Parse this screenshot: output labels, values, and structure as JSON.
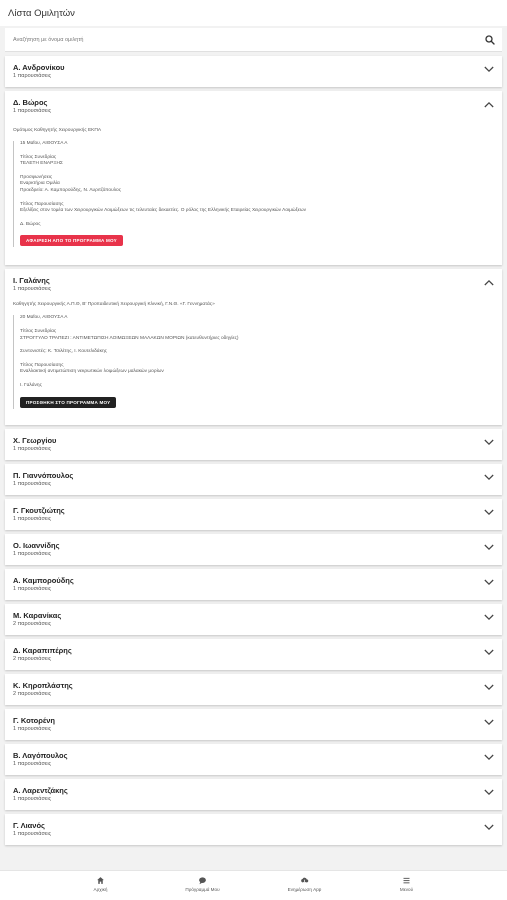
{
  "header": {
    "title": "Λίστα Ομιλητών"
  },
  "search": {
    "placeholder": "Αναζήτηση με όνομα ομιλητή"
  },
  "speakers": [
    {
      "name": "Α. Ανδρονίκου",
      "count": "1 παρουσιάσεις"
    },
    {
      "name": "Δ. Βώρος",
      "count": "1 παρουσιάσεις",
      "role": "Ομότιμος Καθηγητής Χειρουργικής ΕΚΠΑ",
      "date_room": "15 Μαΐου, ΑΙΘΟΥΣΑ Α",
      "session_label": "Τίτλος Συνεδρίας",
      "session_title": "ΤΕΛΕΤΗ ΕΝΑΡΞΗΣ",
      "pres_label": "Προσφωνήσεις",
      "pres_line1": "Εναρκτήρια Ομιλία",
      "pres_line2": "Προεδρείο: Α. Καμπορούδης, Ν. Λυριτζόπουλος",
      "talk_label": "Τίτλος Παρουσίασης",
      "talk_title": "Εξελίξεις στον τομέα των Χειρουργικών Λοιμώξεων τις τελευταίες δεκαετίες. Ο ρόλος της Ελληνικής Εταιρείας Χειρουργικών Λοιμώξεων",
      "speaker_ref": "Δ. Βώρος",
      "button": "ΑΦΑΙΡΕΣΗ ΑΠΟ ΤΟ ΠΡΟΓΡΑΜΜΑ ΜΟΥ"
    },
    {
      "name": "Ι. Γαλάνης",
      "count": "1 παρουσιάσεις",
      "role": "Καθηγητής Χειρουργικής Α.Π.Θ, Β' Προπαιδευτική Χειρουργική Κλινική, Γ.Ν.Θ. «Γ. Γεννηματάς»",
      "date_room": "20 Μαΐου, ΑΙΘΟΥΣΑ Α",
      "session_label": "Τίτλος Συνεδρίας",
      "session_title": "ΣΤΡΟΓΓΥΛΟ ΤΡΑΠΕΖΙ : ΑΝΤΙΜΕΤΩΠΙΣΗ ΛΟΙΜΩΞΕΩΝ ΜΑΛΑΚΩΝ ΜΟΡΙΩΝ (κατευθυντήριες οδηγίες)",
      "coord_line": "Συντονιστές: Κ. Τσιλέτης, Ι. Κουτελιδάκης",
      "talk_label": "Τίτλος Παρουσίασης",
      "talk_title": "Εναλλακτική αντιμετώπιση νεκρωτικών λοιμώξεων μαλακών μορίων",
      "speaker_ref": "Ι. Γαλάνης",
      "button": "ΠΡΟΣΘΗΚΗ ΣΤΟ ΠΡΟΓΡΑΜΜΑ ΜΟΥ"
    },
    {
      "name": "Χ. Γεωργίου",
      "count": "1 παρουσιάσεις"
    },
    {
      "name": "Π. Γιαννόπουλος",
      "count": "1 παρουσιάσεις"
    },
    {
      "name": "Γ. Γκουτζιώτης",
      "count": "1 παρουσιάσεις"
    },
    {
      "name": "Ο. Ιωαννίδης",
      "count": "1 παρουσιάσεις"
    },
    {
      "name": "Α. Καμπορούδης",
      "count": "1 παρουσιάσεις"
    },
    {
      "name": "Μ. Καρανίκας",
      "count": "2 παρουσιάσεις"
    },
    {
      "name": "Δ. Καραπιπέρης",
      "count": "2 παρουσιάσεις"
    },
    {
      "name": "Κ. Κηροπλάστης",
      "count": "2 παρουσιάσεις"
    },
    {
      "name": "Γ. Κοτορένη",
      "count": "1 παρουσιάσεις"
    },
    {
      "name": "Β. Λαγόπουλος",
      "count": "1 παρουσιάσεις"
    },
    {
      "name": "Α. Λαρεντζάκης",
      "count": "1 παρουσιάσεις"
    },
    {
      "name": "Γ. Λιανός",
      "count": "1 παρουσιάσεις"
    }
  ],
  "nav": [
    {
      "label": "Αρχική",
      "icon": "home-icon"
    },
    {
      "label": "Πρόγραμμά Μου",
      "icon": "chat-icon"
    },
    {
      "label": "Ενημέρωση App",
      "icon": "cloud-download-icon"
    },
    {
      "label": "Μενού",
      "icon": "menu-icon"
    }
  ],
  "colors": {
    "remove_button": "#e8334a",
    "add_button": "#222222"
  }
}
